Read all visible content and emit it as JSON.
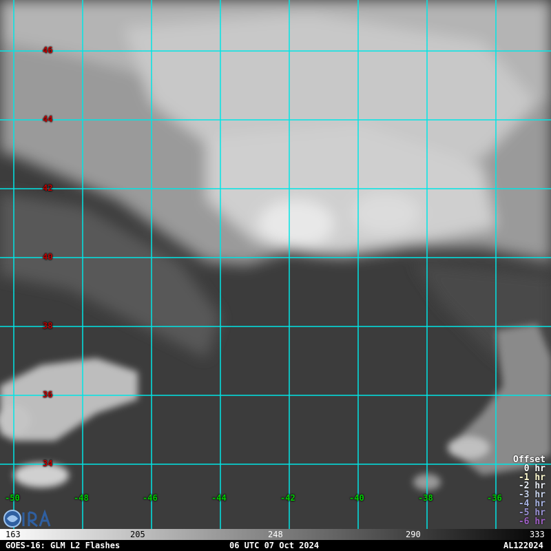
{
  "latitudes": [
    {
      "value": "46"
    },
    {
      "value": "44"
    },
    {
      "value": "42"
    },
    {
      "value": "40"
    },
    {
      "value": "38"
    },
    {
      "value": "36"
    },
    {
      "value": "34"
    }
  ],
  "longitudes": [
    {
      "value": "-50"
    },
    {
      "value": "-48"
    },
    {
      "value": "-46"
    },
    {
      "value": "-44"
    },
    {
      "value": "-42"
    },
    {
      "value": "-40"
    },
    {
      "value": "-38"
    },
    {
      "value": "-36"
    }
  ],
  "legend": {
    "title": "Offset",
    "entries": [
      {
        "label": "0 hr",
        "color": "#ffffff"
      },
      {
        "label": "-1 hr",
        "color": "#fffbd0"
      },
      {
        "label": "-2 hr",
        "color": "#e8ecf4"
      },
      {
        "label": "-3 hr",
        "color": "#c8d4ec"
      },
      {
        "label": "-4 hr",
        "color": "#a8b4e4"
      },
      {
        "label": "-5 hr",
        "color": "#9c94d8"
      },
      {
        "label": "-6 hr",
        "color": "#a060c8"
      }
    ]
  },
  "colorbar": {
    "ticks": [
      "163",
      "205",
      "248",
      "290",
      "333"
    ]
  },
  "footer": {
    "left": "GOES-16: GLM L2 Flashes",
    "center": "06 UTC 07 Oct 2024",
    "right": "AL122024"
  },
  "colors": {
    "grid": "#00e5e5",
    "lat_label": "#c00000",
    "lon_label": "#00cc00"
  }
}
